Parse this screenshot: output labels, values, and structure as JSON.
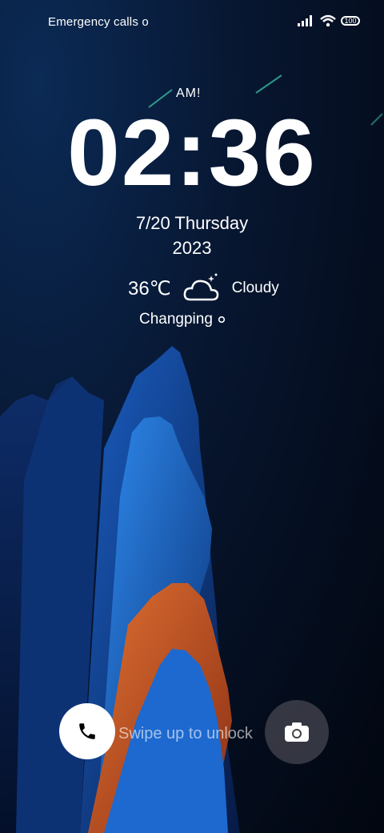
{
  "status": {
    "left_text": "Emergency calls o",
    "battery": "100"
  },
  "clock": {
    "ampm": "AM!",
    "time": "02:36",
    "date": "7/20  Thursday",
    "year": "2023"
  },
  "weather": {
    "temp": "36℃",
    "condition": "Cloudy",
    "location": "Changping",
    "icon": "cloudy-night-icon"
  },
  "bottom": {
    "swipe_text": "Swipe up to unlock",
    "call_icon": "phone-icon",
    "camera_icon": "camera-icon"
  },
  "colors": {
    "bg_dark": "#02060f",
    "bg_blue": "#0b2a55",
    "mountain_blue": "#1f6fd0",
    "mountain_orange": "#c4562a"
  }
}
